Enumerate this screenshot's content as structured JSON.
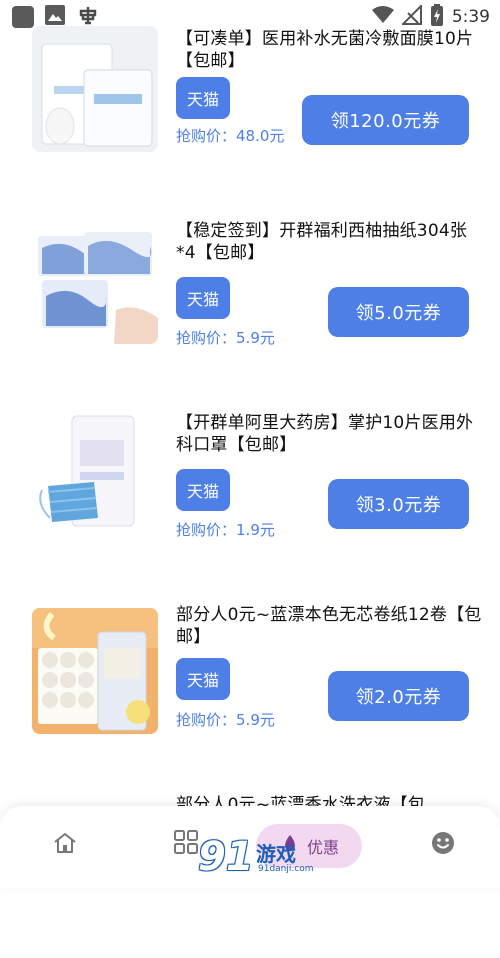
{
  "status_bar": {
    "time": "5:39",
    "left_icons": [
      "square-icon",
      "image-icon",
      "bug-icon"
    ],
    "right_icons": [
      "wifi-icon",
      "no-signal-icon",
      "battery-charging-icon"
    ]
  },
  "products": [
    {
      "title": "【可凑单】医用补水无菌冷敷面膜10片【包邮】",
      "tag": "天猫",
      "price_label": "抢购价：",
      "price": "48.0元",
      "coupon": "领120.0元券",
      "image_icon": "face-mask-package-icon"
    },
    {
      "title": "【稳定签到】开群福利西柚抽纸304张*4【包邮】",
      "tag": "天猫",
      "price_label": "抢购价：",
      "price": "5.9元",
      "coupon": "领5.0元券",
      "image_icon": "tissue-pack-icon"
    },
    {
      "title": "【开群单阿里大药房】掌护10片医用外科口罩【包邮】",
      "tag": "天猫",
      "price_label": "抢购价：",
      "price": "1.9元",
      "coupon": "领3.0元券",
      "image_icon": "surgical-mask-icon"
    },
    {
      "title": "部分人0元~蓝漂本色无芯卷纸12卷【包邮】",
      "tag": "天猫",
      "price_label": "抢购价：",
      "price": "5.9元",
      "coupon": "领2.0元券",
      "image_icon": "toilet-paper-rolls-icon"
    },
    {
      "title": "部分人0元~蓝漂香水洗衣液【包",
      "image_icon": ""
    }
  ],
  "bottom_nav": {
    "active_label": "优惠",
    "items": [
      "home-icon",
      "grid-icon",
      "discount-icon",
      "smile-icon"
    ]
  },
  "watermark": {
    "logo": "91",
    "name": "游戏",
    "url": "91danji.com"
  },
  "colors": {
    "accent": "#4d7fe6",
    "active_tab_bg": "#f3d9ef",
    "active_tab_text": "#7d3d8c"
  }
}
